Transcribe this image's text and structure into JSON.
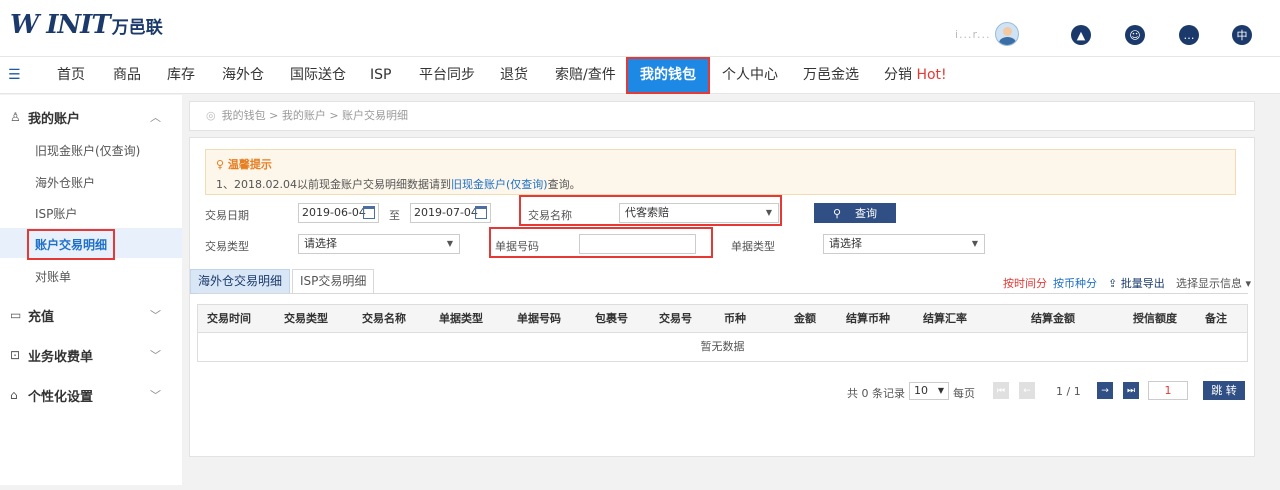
{
  "header": {
    "logo_mark": "W INIT",
    "logo_text": "万邑联",
    "username": "i...r...",
    "icons": [
      "upload-icon",
      "support-icon",
      "message-icon",
      "language-icon"
    ],
    "lang_label": "中"
  },
  "nav": {
    "toggle_icon": "menu-toggle-icon",
    "items": [
      "首页",
      "商品",
      "库存",
      "海外仓",
      "国际送仓",
      "ISP",
      "平台同步",
      "退货",
      "索赔/查件",
      "我的钱包",
      "个人中心",
      "万邑金选",
      "分销"
    ],
    "hot_label": "Hot!",
    "active_index": 9
  },
  "sidebar": {
    "groups": [
      {
        "label": "我的账户",
        "icon": "user-icon"
      },
      {
        "label": "充值",
        "icon": "recharge-icon"
      },
      {
        "label": "业务收费单",
        "icon": "bill-icon"
      },
      {
        "label": "个性化设置",
        "icon": "settings-icon"
      }
    ],
    "items": [
      "旧现金账户(仅查询)",
      "海外仓账户",
      "ISP账户",
      "账户交易明细",
      "对账单"
    ],
    "selected_index": 3
  },
  "breadcrumb": "我的钱包 > 我的账户 > 账户交易明细",
  "tip": {
    "title": "温馨提示",
    "line_prefix": "1、2018.02.04以前现金账户交易明细数据请到",
    "line_link": "旧现金账户(仅查询)",
    "line_suffix": "查询。"
  },
  "form": {
    "trade_date_label": "交易日期",
    "date_from": "2019-06-04",
    "date_to_sep": "至",
    "date_to": "2019-07-04",
    "trade_name_label": "交易名称",
    "trade_name_value": "代客索赔",
    "query_button": "查询",
    "trade_type_label": "交易类型",
    "trade_type_value": "请选择",
    "doc_no_label": "单据号码",
    "doc_no_value": "",
    "doc_type_label": "单据类型",
    "doc_type_value": "请选择"
  },
  "tabs": [
    "海外仓交易明细",
    "ISP交易明细"
  ],
  "tools": {
    "by_time": "按时间分",
    "by_currency": "按币种分",
    "batch_export": "批量导出",
    "choose_info": "选择显示信息"
  },
  "table": {
    "columns": [
      "交易时间",
      "交易类型",
      "交易名称",
      "单据类型",
      "单据号码",
      "包裹号",
      "交易号",
      "币种",
      "金额",
      "结算币种",
      "结算汇率",
      "结算金额",
      "授信额度",
      "备注"
    ],
    "empty_text": "暂无数据"
  },
  "pager": {
    "total_text": "共 0 条记录",
    "per_page": "10",
    "per_page_suffix": "每页",
    "page_info": "1 / 1",
    "page_input": "1",
    "go_label": "跳 转"
  },
  "colors": {
    "brand": "#1b3a6b",
    "active_nav": "#1e88e5",
    "highlight_box": "#e53935",
    "button": "#2f4f85"
  }
}
